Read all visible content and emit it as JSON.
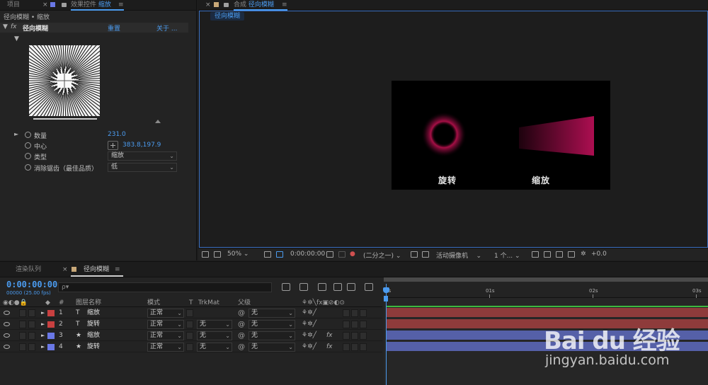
{
  "left_panel": {
    "tabs": {
      "project": "项目",
      "effect_controls": "效果控件",
      "effect_controls_layer": "缩放",
      "label_color": "#6a78e6"
    },
    "subtitle": "径向模糊 • 缩放",
    "effect": {
      "name": "径向模糊",
      "reset_label": "重置",
      "about_label": "关于 ..."
    },
    "properties": [
      {
        "name": "数量",
        "value": "231.0"
      },
      {
        "name": "中心",
        "value": "383.8,197.9"
      },
      {
        "name": "类型",
        "value": "缩放"
      },
      {
        "name": "消除锯齿（最佳品质）",
        "value": "低"
      }
    ]
  },
  "viewer": {
    "tab_prefix": "合成",
    "tab_name": "径向模糊",
    "tab_color": "#c8a878",
    "comp_chip": "径向模糊",
    "canvas_labels": {
      "left": "旋转",
      "right": "缩放"
    },
    "toolbar": {
      "zoom": "50%",
      "timecode": "0:00:00:00",
      "resolution": "(二分之一)",
      "camera": "活动摄像机",
      "views": "1 个...",
      "exposure": "+0.0"
    }
  },
  "timeline": {
    "tabs": {
      "render_queue": "渲染队列",
      "comp": "径向模糊",
      "comp_color": "#c8a878"
    },
    "timecode": "0:00:00:00",
    "timecode_sub": "00000 (25.00 fps)",
    "search_placeholder": "ρ▾",
    "headers": {
      "hash": "#",
      "layer_name": "图层名称",
      "mode": "模式",
      "t": "T",
      "trkmat": "TrkMat",
      "parent": "父级"
    },
    "layers": [
      {
        "num": "1",
        "type": "T",
        "name": "缩放",
        "mode": "正常",
        "trkmat": "",
        "parent": "无",
        "color": "#c84040",
        "has_fx": false
      },
      {
        "num": "2",
        "type": "T",
        "name": "旋转",
        "mode": "正常",
        "trkmat": "无",
        "parent": "无",
        "color": "#c84040",
        "has_fx": false
      },
      {
        "num": "3",
        "type": "★",
        "name": "缩放",
        "mode": "正常",
        "trkmat": "无",
        "parent": "无",
        "color": "#6a78e6",
        "has_fx": true
      },
      {
        "num": "4",
        "type": "★",
        "name": "旋转",
        "mode": "正常",
        "trkmat": "无",
        "parent": "无",
        "color": "#6a78e6",
        "has_fx": true
      }
    ],
    "fx_label": "fx",
    "ruler": {
      "t0": "0s",
      "t1": "01s",
      "t2": "02s",
      "t3": "03s"
    },
    "track_colors": [
      "#8e3b3b",
      "#8e3b3b",
      "#5560a8",
      "#5560a8"
    ]
  },
  "watermark": {
    "logo": "Bai du 经验",
    "url": "jingyan.baidu.com"
  }
}
